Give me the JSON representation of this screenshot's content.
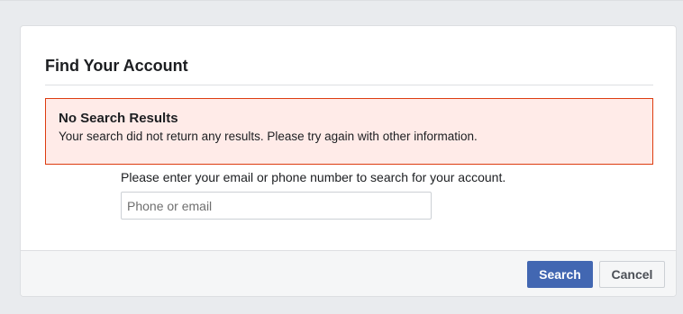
{
  "dialog": {
    "title": "Find Your Account"
  },
  "error": {
    "title": "No Search Results",
    "message": "Your search did not return any results. Please try again with other information."
  },
  "form": {
    "instructions": "Please enter your email or phone number to search for your account.",
    "input_value": "",
    "input_placeholder": "Phone or email"
  },
  "footer": {
    "search_label": "Search",
    "cancel_label": "Cancel"
  },
  "colors": {
    "page_background": "#e9ebee",
    "primary_button": "#4267b2",
    "error_background": "#ffebe8",
    "error_border": "#dd3c10"
  }
}
